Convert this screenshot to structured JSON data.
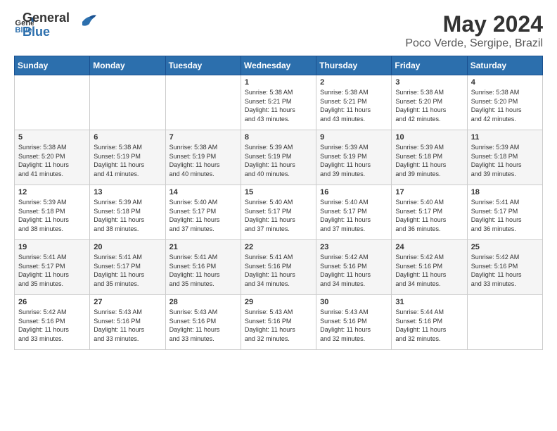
{
  "header": {
    "logo_general": "General",
    "logo_blue": "Blue",
    "title": "May 2024",
    "subtitle": "Poco Verde, Sergipe, Brazil"
  },
  "calendar": {
    "weekdays": [
      "Sunday",
      "Monday",
      "Tuesday",
      "Wednesday",
      "Thursday",
      "Friday",
      "Saturday"
    ],
    "weeks": [
      [
        {
          "day": "",
          "text": ""
        },
        {
          "day": "",
          "text": ""
        },
        {
          "day": "",
          "text": ""
        },
        {
          "day": "1",
          "text": "Sunrise: 5:38 AM\nSunset: 5:21 PM\nDaylight: 11 hours\nand 43 minutes."
        },
        {
          "day": "2",
          "text": "Sunrise: 5:38 AM\nSunset: 5:21 PM\nDaylight: 11 hours\nand 43 minutes."
        },
        {
          "day": "3",
          "text": "Sunrise: 5:38 AM\nSunset: 5:20 PM\nDaylight: 11 hours\nand 42 minutes."
        },
        {
          "day": "4",
          "text": "Sunrise: 5:38 AM\nSunset: 5:20 PM\nDaylight: 11 hours\nand 42 minutes."
        }
      ],
      [
        {
          "day": "5",
          "text": "Sunrise: 5:38 AM\nSunset: 5:20 PM\nDaylight: 11 hours\nand 41 minutes."
        },
        {
          "day": "6",
          "text": "Sunrise: 5:38 AM\nSunset: 5:19 PM\nDaylight: 11 hours\nand 41 minutes."
        },
        {
          "day": "7",
          "text": "Sunrise: 5:38 AM\nSunset: 5:19 PM\nDaylight: 11 hours\nand 40 minutes."
        },
        {
          "day": "8",
          "text": "Sunrise: 5:39 AM\nSunset: 5:19 PM\nDaylight: 11 hours\nand 40 minutes."
        },
        {
          "day": "9",
          "text": "Sunrise: 5:39 AM\nSunset: 5:19 PM\nDaylight: 11 hours\nand 39 minutes."
        },
        {
          "day": "10",
          "text": "Sunrise: 5:39 AM\nSunset: 5:18 PM\nDaylight: 11 hours\nand 39 minutes."
        },
        {
          "day": "11",
          "text": "Sunrise: 5:39 AM\nSunset: 5:18 PM\nDaylight: 11 hours\nand 39 minutes."
        }
      ],
      [
        {
          "day": "12",
          "text": "Sunrise: 5:39 AM\nSunset: 5:18 PM\nDaylight: 11 hours\nand 38 minutes."
        },
        {
          "day": "13",
          "text": "Sunrise: 5:39 AM\nSunset: 5:18 PM\nDaylight: 11 hours\nand 38 minutes."
        },
        {
          "day": "14",
          "text": "Sunrise: 5:40 AM\nSunset: 5:17 PM\nDaylight: 11 hours\nand 37 minutes."
        },
        {
          "day": "15",
          "text": "Sunrise: 5:40 AM\nSunset: 5:17 PM\nDaylight: 11 hours\nand 37 minutes."
        },
        {
          "day": "16",
          "text": "Sunrise: 5:40 AM\nSunset: 5:17 PM\nDaylight: 11 hours\nand 37 minutes."
        },
        {
          "day": "17",
          "text": "Sunrise: 5:40 AM\nSunset: 5:17 PM\nDaylight: 11 hours\nand 36 minutes."
        },
        {
          "day": "18",
          "text": "Sunrise: 5:41 AM\nSunset: 5:17 PM\nDaylight: 11 hours\nand 36 minutes."
        }
      ],
      [
        {
          "day": "19",
          "text": "Sunrise: 5:41 AM\nSunset: 5:17 PM\nDaylight: 11 hours\nand 35 minutes."
        },
        {
          "day": "20",
          "text": "Sunrise: 5:41 AM\nSunset: 5:17 PM\nDaylight: 11 hours\nand 35 minutes."
        },
        {
          "day": "21",
          "text": "Sunrise: 5:41 AM\nSunset: 5:16 PM\nDaylight: 11 hours\nand 35 minutes."
        },
        {
          "day": "22",
          "text": "Sunrise: 5:41 AM\nSunset: 5:16 PM\nDaylight: 11 hours\nand 34 minutes."
        },
        {
          "day": "23",
          "text": "Sunrise: 5:42 AM\nSunset: 5:16 PM\nDaylight: 11 hours\nand 34 minutes."
        },
        {
          "day": "24",
          "text": "Sunrise: 5:42 AM\nSunset: 5:16 PM\nDaylight: 11 hours\nand 34 minutes."
        },
        {
          "day": "25",
          "text": "Sunrise: 5:42 AM\nSunset: 5:16 PM\nDaylight: 11 hours\nand 33 minutes."
        }
      ],
      [
        {
          "day": "26",
          "text": "Sunrise: 5:42 AM\nSunset: 5:16 PM\nDaylight: 11 hours\nand 33 minutes."
        },
        {
          "day": "27",
          "text": "Sunrise: 5:43 AM\nSunset: 5:16 PM\nDaylight: 11 hours\nand 33 minutes."
        },
        {
          "day": "28",
          "text": "Sunrise: 5:43 AM\nSunset: 5:16 PM\nDaylight: 11 hours\nand 33 minutes."
        },
        {
          "day": "29",
          "text": "Sunrise: 5:43 AM\nSunset: 5:16 PM\nDaylight: 11 hours\nand 32 minutes."
        },
        {
          "day": "30",
          "text": "Sunrise: 5:43 AM\nSunset: 5:16 PM\nDaylight: 11 hours\nand 32 minutes."
        },
        {
          "day": "31",
          "text": "Sunrise: 5:44 AM\nSunset: 5:16 PM\nDaylight: 11 hours\nand 32 minutes."
        },
        {
          "day": "",
          "text": ""
        }
      ]
    ]
  }
}
